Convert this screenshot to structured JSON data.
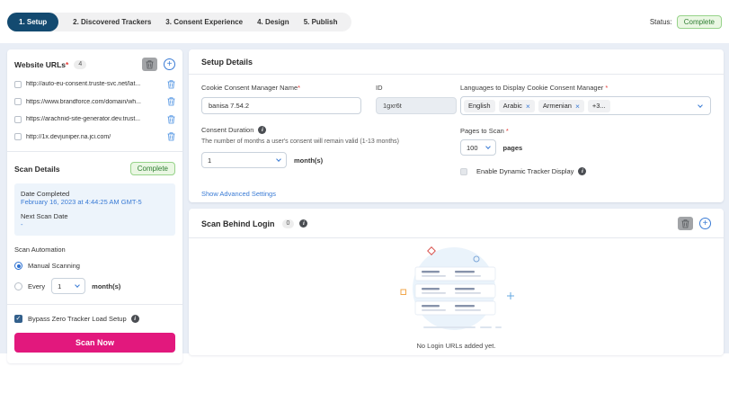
{
  "stepper": {
    "steps": [
      {
        "label": "1. Setup"
      },
      {
        "label": "2. Discovered Trackers"
      },
      {
        "label": "3. Consent Experience"
      },
      {
        "label": "4. Design"
      },
      {
        "label": "5. Publish"
      }
    ]
  },
  "status": {
    "label": "Status:",
    "value": "Complete"
  },
  "sidebar": {
    "title": "Website URLs",
    "required": "*",
    "count": "4",
    "urls": [
      "http://auto-eu-consent.truste-svc.net/lat...",
      "https://www.brandforce.com/domain/wh...",
      "https://arachnid-site-generator.dev.trust...",
      "http://1x.devjuniper.na.jci.com/"
    ],
    "scan_details": {
      "title": "Scan Details",
      "status_badge": "Complete",
      "date_completed_label": "Date Completed",
      "date_completed_value": "February 16, 2023 at 4:44:25 AM GMT-5",
      "next_scan_label": "Next Scan Date",
      "next_scan_value": "-"
    },
    "scan_automation": {
      "label": "Scan Automation",
      "manual_option": "Manual Scanning",
      "every_label": "Every",
      "every_value": "1",
      "every_unit": "month(s)"
    },
    "bypass_label": "Bypass Zero Tracker Load Setup",
    "scan_now_button": "Scan Now"
  },
  "setup_details": {
    "title": "Setup Details",
    "name_label": "Cookie Consent Manager Name",
    "required": "*",
    "name_value": "banisa 7.54.2",
    "id_label": "ID",
    "id_value": "1gxr6t",
    "languages_label": "Languages to Display Cookie Consent Manager",
    "languages_tags": [
      {
        "label": "English"
      },
      {
        "label": "Arabic"
      },
      {
        "label": "Armenian"
      },
      {
        "label": "+3..."
      }
    ],
    "consent_duration_label": "Consent Duration",
    "consent_duration_help": "The number of months a user's consent will remain valid (1-13 months)",
    "consent_duration_value": "1",
    "consent_duration_unit": "month(s)",
    "pages_label": "Pages to Scan",
    "pages_value": "100",
    "pages_unit": "pages",
    "dynamic_tracker_label": "Enable Dynamic Tracker Display",
    "advanced_link": "Show Advanced Settings"
  },
  "scan_behind_login": {
    "title": "Scan Behind Login",
    "count": "0",
    "empty_text": "No Login URLs added yet."
  },
  "icons": {
    "remove": "×",
    "plus": "+"
  },
  "colors": {
    "accent_pink": "#e2187d",
    "active_step_navy": "#134a70",
    "link_blue": "#3a7bd5",
    "success_green_text": "#2e7d32",
    "success_green_bg": "#eaf7e3",
    "content_bg": "#e9eef6"
  }
}
